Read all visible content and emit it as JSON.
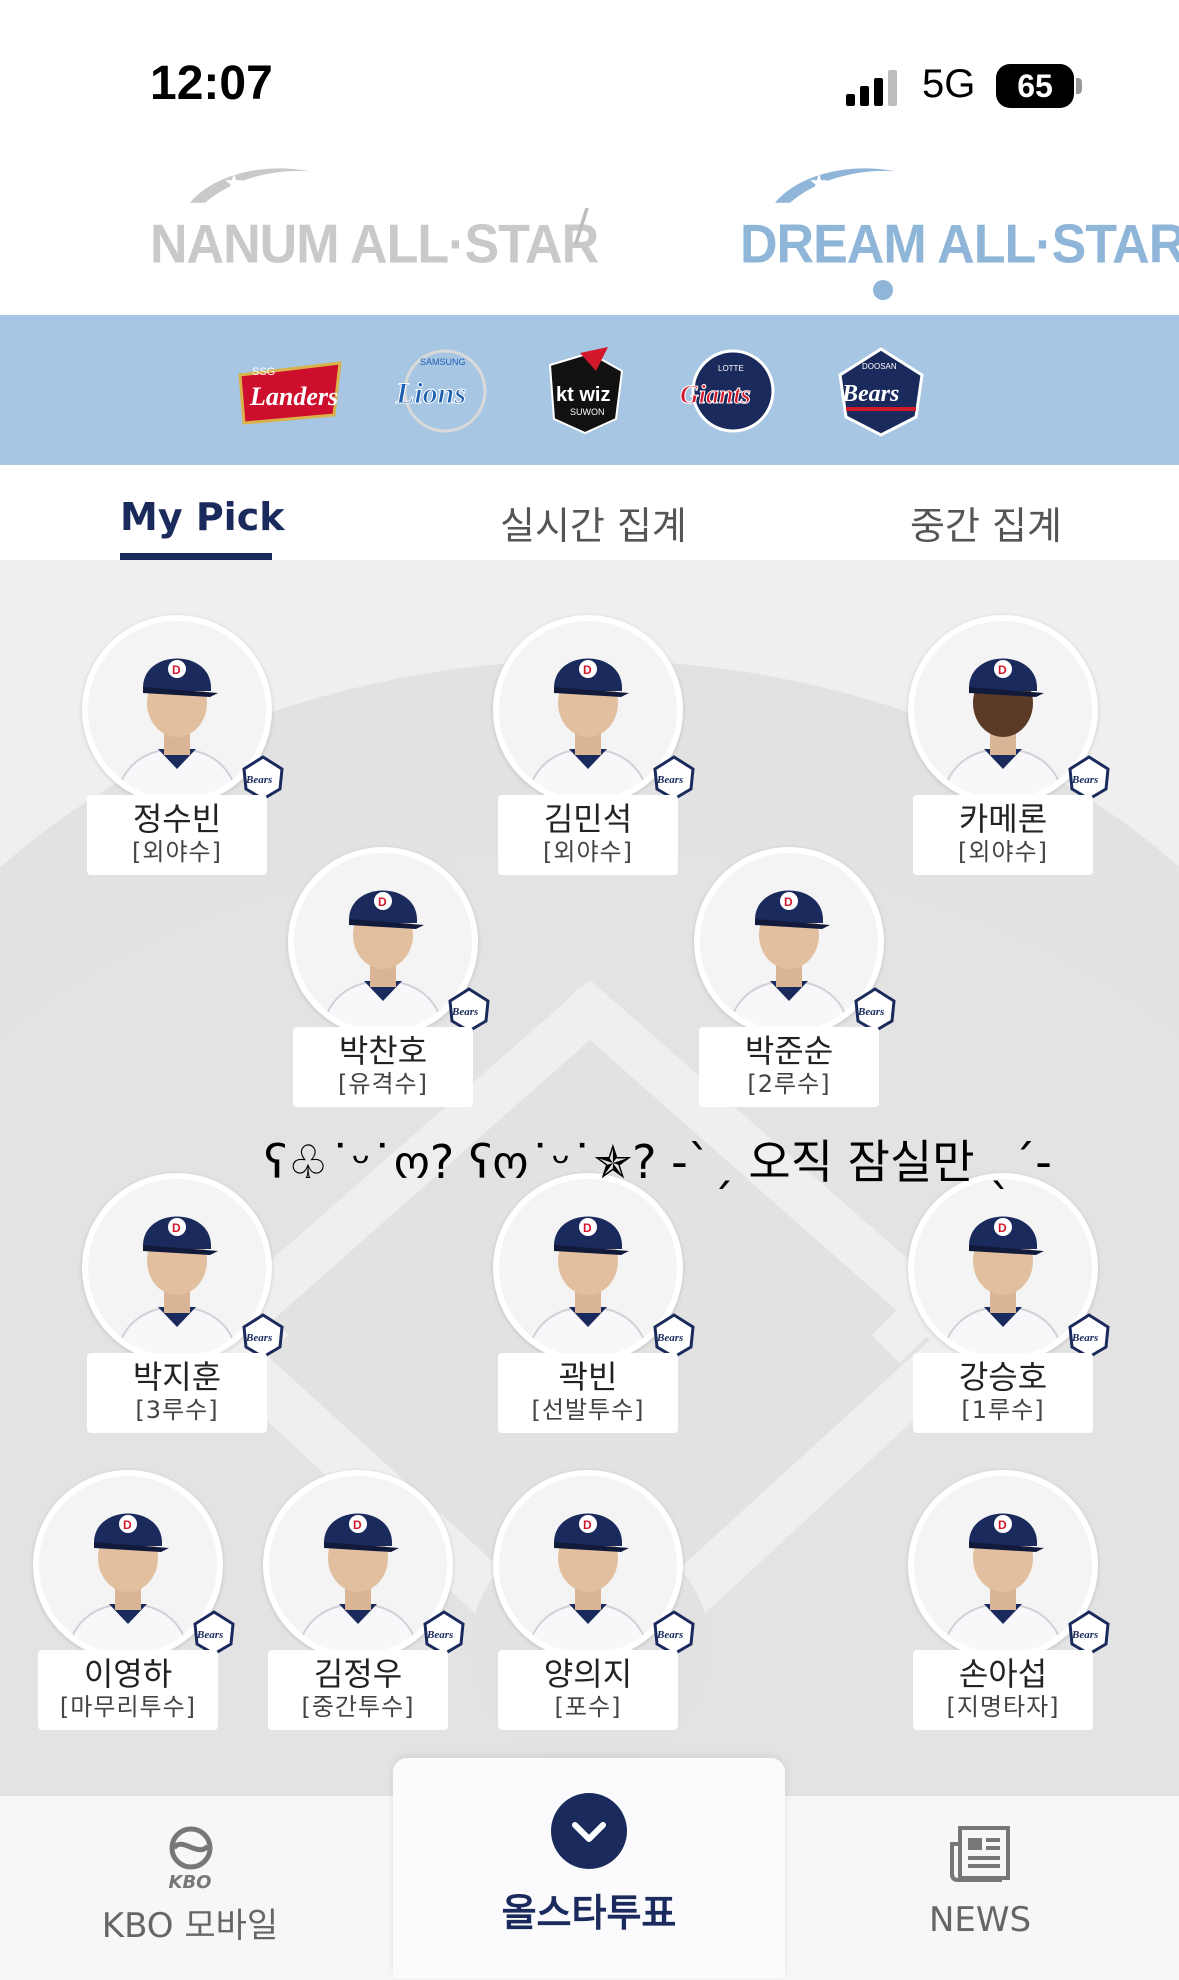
{
  "status_bar": {
    "time": "12:07",
    "network": "5G",
    "battery": "65"
  },
  "league_header": {
    "left": "NANUM ALL·STAR",
    "separator": "/",
    "right": "DREAM ALL·STAR",
    "selected": "right"
  },
  "teams": [
    {
      "logo_text": "Landers",
      "top_text": "SSG",
      "color": "#ce0e2d"
    },
    {
      "logo_text": "Lions",
      "top_text": "SAMSUNG",
      "color": "#1d5fb0"
    },
    {
      "logo_text": "kt wiz",
      "top_text": "SUWON",
      "color": "#111111"
    },
    {
      "logo_text": "Giants",
      "top_text": "LOTTE",
      "color": "#d3182c"
    },
    {
      "logo_text": "Bears",
      "top_text": "DOOSAN",
      "color": "#1a2a5c"
    }
  ],
  "tabs": [
    {
      "label": "My Pick",
      "active": true
    },
    {
      "label": "실시간 집계",
      "active": false
    },
    {
      "label": "중간 집계",
      "active": false
    }
  ],
  "players": [
    {
      "name": "정수빈",
      "position": "[외야수]"
    },
    {
      "name": "김민석",
      "position": "[외야수]"
    },
    {
      "name": "카메론",
      "position": "[외야수]"
    },
    {
      "name": "박찬호",
      "position": "[유격수]"
    },
    {
      "name": "박준순",
      "position": "[2루수]"
    },
    {
      "name": "박지훈",
      "position": "[3루수]"
    },
    {
      "name": "곽빈",
      "position": "[선발투수]"
    },
    {
      "name": "강승호",
      "position": "[1루수]"
    },
    {
      "name": "이영하",
      "position": "[마무리투수]"
    },
    {
      "name": "김정우",
      "position": "[중간투수]"
    },
    {
      "name": "양의지",
      "position": "[포수]"
    },
    {
      "name": "손아섭",
      "position": "[지명타자]"
    }
  ],
  "overlay_text": "ʕ♧˙ᵕ˙ო? ʕო˙ᵕ˙✯? -ˋˏ 오직 잠실만 ˎˊ-",
  "team_badge_text": "Bears",
  "bottom_nav": {
    "left_logo": "KBO",
    "left_label": "KBO 모바일",
    "center_label": "올스타투표",
    "right_label": "NEWS"
  },
  "colors": {
    "navy": "#1a2a5c",
    "team_band": "#a6c6e3",
    "dream_accent": "#8fb6d8",
    "field": "#efefef"
  }
}
